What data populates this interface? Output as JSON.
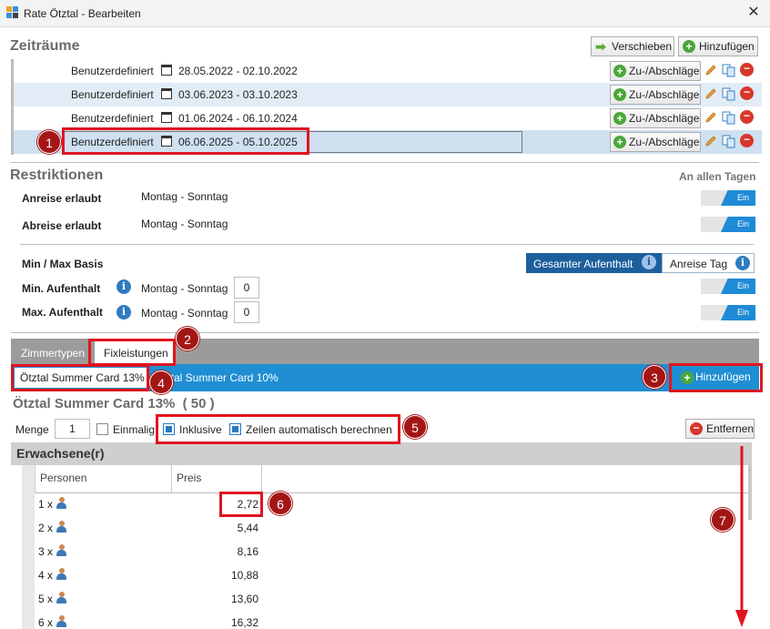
{
  "window": {
    "title": "Rate Ötztal - Bearbeiten",
    "close": "✕"
  },
  "zeitraeume": {
    "heading": "Zeiträume",
    "shift_label": "Verschieben",
    "add_label": "Hinzufügen",
    "rows": [
      {
        "type": "Benutzerdefiniert",
        "dates": "28.05.2022 - 02.10.2022",
        "action": "Zu-/Abschläge"
      },
      {
        "type": "Benutzerdefiniert",
        "dates": "03.06.2023 - 03.10.2023",
        "action": "Zu-/Abschläge"
      },
      {
        "type": "Benutzerdefiniert",
        "dates": "01.06.2024 - 06.10.2024",
        "action": "Zu-/Abschläge"
      },
      {
        "type": "Benutzerdefiniert",
        "dates": "06.06.2025 - 05.10.2025",
        "action": "Zu-/Abschläge"
      }
    ]
  },
  "restriktionen": {
    "heading": "Restriktionen",
    "all_days": "An allen Tagen",
    "arrival_label": "Anreise erlaubt",
    "arrival_value": "Montag - Sonntag",
    "arrival_toggle": "Ein",
    "departure_label": "Abreise erlaubt",
    "departure_value": "Montag - Sonntag",
    "departure_toggle": "Ein",
    "minmax_label": "Min / Max Basis",
    "mode_total": "Gesamter Aufenthalt",
    "mode_arrival": "Anreise Tag",
    "min_label": "Min. Aufenthalt",
    "min_days": "Montag - Sonntag",
    "min_value": "0",
    "min_toggle": "Ein",
    "max_label": "Max. Aufenthalt",
    "max_days": "Montag - Sonntag",
    "max_value": "0",
    "max_toggle": "Ein"
  },
  "tabs": {
    "zimmertypen": "Zimmertypen",
    "fixleistungen": "Fixleistungen"
  },
  "services": {
    "items": [
      "Ötztal Summer Card 13%",
      "Ötztal Summer Card 10%"
    ],
    "add_label": "Hinzufügen"
  },
  "detail": {
    "title": "Ötztal Summer Card 13%",
    "count": "( 50 )",
    "menge_label": "Menge",
    "menge_value": "1",
    "einmalig": "Einmalig",
    "inklusive": "Inklusive",
    "auto": "Zeilen automatisch berechnen",
    "remove": "Entfernen"
  },
  "grid": {
    "group": "Erwachsene(r)",
    "col_persons": "Personen",
    "col_price": "Preis",
    "rows": [
      {
        "n": "1 x",
        "p": "2,72"
      },
      {
        "n": "2 x",
        "p": "5,44"
      },
      {
        "n": "3 x",
        "p": "8,16"
      },
      {
        "n": "4 x",
        "p": "10,88"
      },
      {
        "n": "5 x",
        "p": "13,60"
      },
      {
        "n": "6 x",
        "p": "16,32"
      }
    ]
  },
  "badges": [
    "1",
    "2",
    "3",
    "4",
    "5",
    "6",
    "7"
  ]
}
